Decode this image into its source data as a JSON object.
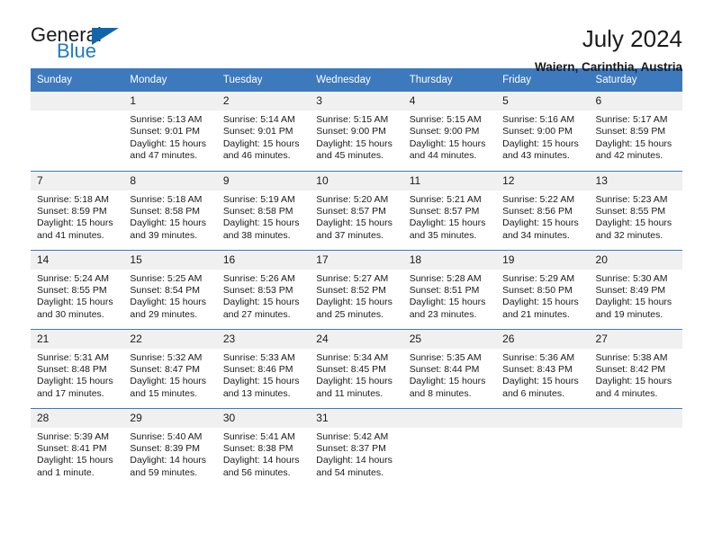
{
  "brand": {
    "name_top": "General",
    "name_bottom": "Blue",
    "accent_color": "#1f7ac4",
    "triangle_color": "#1166ab"
  },
  "header": {
    "title": "July 2024",
    "subtitle": "Waiern, Carinthia, Austria"
  },
  "theme": {
    "header_row_bg": "#3d79bd",
    "header_row_text": "#ffffff",
    "daynum_bg": "#f0f0f0",
    "week_separator": "#3d79bd",
    "page_bg": "#ffffff",
    "body_text": "#1a1a1a"
  },
  "labels": {
    "sunrise_prefix": "Sunrise:",
    "sunset_prefix": "Sunset:",
    "daylight_prefix": "Daylight:"
  },
  "weekday_headers": [
    "Sunday",
    "Monday",
    "Tuesday",
    "Wednesday",
    "Thursday",
    "Friday",
    "Saturday"
  ],
  "weeks": [
    [
      {
        "date": "",
        "sunrise": "",
        "sunset": "",
        "daylight": "",
        "empty": true
      },
      {
        "date": "1",
        "sunrise": "Sunrise: 5:13 AM",
        "sunset": "Sunset: 9:01 PM",
        "daylight": "Daylight: 15 hours and 47 minutes."
      },
      {
        "date": "2",
        "sunrise": "Sunrise: 5:14 AM",
        "sunset": "Sunset: 9:01 PM",
        "daylight": "Daylight: 15 hours and 46 minutes."
      },
      {
        "date": "3",
        "sunrise": "Sunrise: 5:15 AM",
        "sunset": "Sunset: 9:00 PM",
        "daylight": "Daylight: 15 hours and 45 minutes."
      },
      {
        "date": "4",
        "sunrise": "Sunrise: 5:15 AM",
        "sunset": "Sunset: 9:00 PM",
        "daylight": "Daylight: 15 hours and 44 minutes."
      },
      {
        "date": "5",
        "sunrise": "Sunrise: 5:16 AM",
        "sunset": "Sunset: 9:00 PM",
        "daylight": "Daylight: 15 hours and 43 minutes."
      },
      {
        "date": "6",
        "sunrise": "Sunrise: 5:17 AM",
        "sunset": "Sunset: 8:59 PM",
        "daylight": "Daylight: 15 hours and 42 minutes."
      }
    ],
    [
      {
        "date": "7",
        "sunrise": "Sunrise: 5:18 AM",
        "sunset": "Sunset: 8:59 PM",
        "daylight": "Daylight: 15 hours and 41 minutes."
      },
      {
        "date": "8",
        "sunrise": "Sunrise: 5:18 AM",
        "sunset": "Sunset: 8:58 PM",
        "daylight": "Daylight: 15 hours and 39 minutes."
      },
      {
        "date": "9",
        "sunrise": "Sunrise: 5:19 AM",
        "sunset": "Sunset: 8:58 PM",
        "daylight": "Daylight: 15 hours and 38 minutes."
      },
      {
        "date": "10",
        "sunrise": "Sunrise: 5:20 AM",
        "sunset": "Sunset: 8:57 PM",
        "daylight": "Daylight: 15 hours and 37 minutes."
      },
      {
        "date": "11",
        "sunrise": "Sunrise: 5:21 AM",
        "sunset": "Sunset: 8:57 PM",
        "daylight": "Daylight: 15 hours and 35 minutes."
      },
      {
        "date": "12",
        "sunrise": "Sunrise: 5:22 AM",
        "sunset": "Sunset: 8:56 PM",
        "daylight": "Daylight: 15 hours and 34 minutes."
      },
      {
        "date": "13",
        "sunrise": "Sunrise: 5:23 AM",
        "sunset": "Sunset: 8:55 PM",
        "daylight": "Daylight: 15 hours and 32 minutes."
      }
    ],
    [
      {
        "date": "14",
        "sunrise": "Sunrise: 5:24 AM",
        "sunset": "Sunset: 8:55 PM",
        "daylight": "Daylight: 15 hours and 30 minutes."
      },
      {
        "date": "15",
        "sunrise": "Sunrise: 5:25 AM",
        "sunset": "Sunset: 8:54 PM",
        "daylight": "Daylight: 15 hours and 29 minutes."
      },
      {
        "date": "16",
        "sunrise": "Sunrise: 5:26 AM",
        "sunset": "Sunset: 8:53 PM",
        "daylight": "Daylight: 15 hours and 27 minutes."
      },
      {
        "date": "17",
        "sunrise": "Sunrise: 5:27 AM",
        "sunset": "Sunset: 8:52 PM",
        "daylight": "Daylight: 15 hours and 25 minutes."
      },
      {
        "date": "18",
        "sunrise": "Sunrise: 5:28 AM",
        "sunset": "Sunset: 8:51 PM",
        "daylight": "Daylight: 15 hours and 23 minutes."
      },
      {
        "date": "19",
        "sunrise": "Sunrise: 5:29 AM",
        "sunset": "Sunset: 8:50 PM",
        "daylight": "Daylight: 15 hours and 21 minutes."
      },
      {
        "date": "20",
        "sunrise": "Sunrise: 5:30 AM",
        "sunset": "Sunset: 8:49 PM",
        "daylight": "Daylight: 15 hours and 19 minutes."
      }
    ],
    [
      {
        "date": "21",
        "sunrise": "Sunrise: 5:31 AM",
        "sunset": "Sunset: 8:48 PM",
        "daylight": "Daylight: 15 hours and 17 minutes."
      },
      {
        "date": "22",
        "sunrise": "Sunrise: 5:32 AM",
        "sunset": "Sunset: 8:47 PM",
        "daylight": "Daylight: 15 hours and 15 minutes."
      },
      {
        "date": "23",
        "sunrise": "Sunrise: 5:33 AM",
        "sunset": "Sunset: 8:46 PM",
        "daylight": "Daylight: 15 hours and 13 minutes."
      },
      {
        "date": "24",
        "sunrise": "Sunrise: 5:34 AM",
        "sunset": "Sunset: 8:45 PM",
        "daylight": "Daylight: 15 hours and 11 minutes."
      },
      {
        "date": "25",
        "sunrise": "Sunrise: 5:35 AM",
        "sunset": "Sunset: 8:44 PM",
        "daylight": "Daylight: 15 hours and 8 minutes."
      },
      {
        "date": "26",
        "sunrise": "Sunrise: 5:36 AM",
        "sunset": "Sunset: 8:43 PM",
        "daylight": "Daylight: 15 hours and 6 minutes."
      },
      {
        "date": "27",
        "sunrise": "Sunrise: 5:38 AM",
        "sunset": "Sunset: 8:42 PM",
        "daylight": "Daylight: 15 hours and 4 minutes."
      }
    ],
    [
      {
        "date": "28",
        "sunrise": "Sunrise: 5:39 AM",
        "sunset": "Sunset: 8:41 PM",
        "daylight": "Daylight: 15 hours and 1 minute."
      },
      {
        "date": "29",
        "sunrise": "Sunrise: 5:40 AM",
        "sunset": "Sunset: 8:39 PM",
        "daylight": "Daylight: 14 hours and 59 minutes."
      },
      {
        "date": "30",
        "sunrise": "Sunrise: 5:41 AM",
        "sunset": "Sunset: 8:38 PM",
        "daylight": "Daylight: 14 hours and 56 minutes."
      },
      {
        "date": "31",
        "sunrise": "Sunrise: 5:42 AM",
        "sunset": "Sunset: 8:37 PM",
        "daylight": "Daylight: 14 hours and 54 minutes."
      },
      {
        "date": "",
        "sunrise": "",
        "sunset": "",
        "daylight": "",
        "empty": true
      },
      {
        "date": "",
        "sunrise": "",
        "sunset": "",
        "daylight": "",
        "empty": true
      },
      {
        "date": "",
        "sunrise": "",
        "sunset": "",
        "daylight": "",
        "empty": true
      }
    ]
  ]
}
